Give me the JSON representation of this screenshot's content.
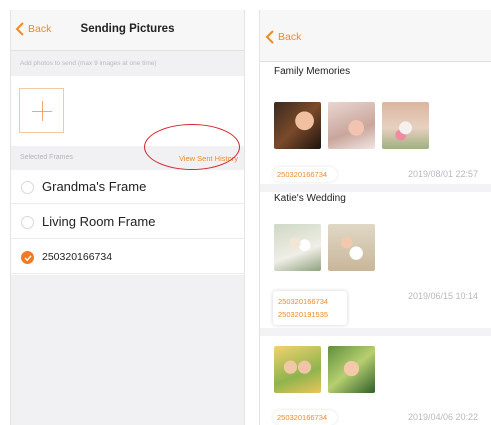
{
  "left_screen": {
    "back_label": "Back",
    "title": "Sending Pictures",
    "hint": "Add photos to send (max 9 images at one time)",
    "selected_frames_label": "Selected Frames",
    "view_history_label": "View Sent History",
    "frames": [
      {
        "label": "Grandma's Frame",
        "checked": false
      },
      {
        "label": "Living Room Frame",
        "checked": false
      },
      {
        "label": "250320166734",
        "checked": true
      }
    ]
  },
  "right_screen": {
    "back_label": "Back",
    "albums": [
      {
        "title": "Family Memories",
        "photos": [
          "couple-photo",
          "baby-photo",
          "toddler-photo"
        ],
        "sent_to": [
          "250320166734"
        ],
        "timestamp": "2019/08/01 22:57"
      },
      {
        "title": "Katie's Wedding",
        "photos": [
          "wedding-photo",
          "bride-groom-photo"
        ],
        "sent_to": [
          "250320166734",
          "250320191535"
        ],
        "timestamp": "2019/06/15 10:14"
      },
      {
        "title": "",
        "photos": [
          "family-photo",
          "kids-photo"
        ],
        "sent_to": [
          "250320166734"
        ],
        "timestamp": "2019/04/06 20:22"
      }
    ]
  },
  "colors": {
    "accent": "#f08a24",
    "highlight_circle": "#d4242b",
    "section_background": "#f1f1f4"
  }
}
